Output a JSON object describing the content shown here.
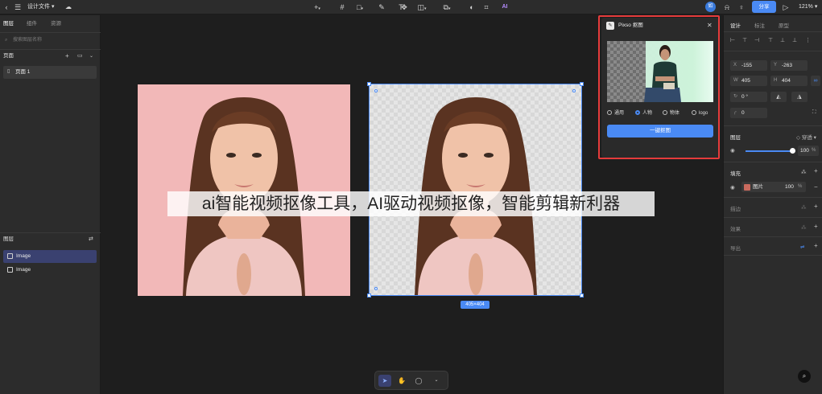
{
  "topbar": {
    "file_title": "设计文件",
    "avatar": "如",
    "share_label": "分享",
    "zoom": "121%",
    "icons": [
      "back-icon",
      "menu-icon",
      "chevron-down-icon",
      "cloud-icon",
      "add-icon",
      "frame-icon",
      "rectangle-icon",
      "pen-icon",
      "text-icon",
      "component-icon",
      "mask-icon",
      "boolean-icon",
      "crop-icon",
      "plugin-ai-icon",
      "bell-icon",
      "bulb-icon",
      "play-icon"
    ]
  },
  "left_panel": {
    "tabs": [
      "图层",
      "组件",
      "资源"
    ],
    "active_tab": "图层",
    "search_placeholder": "搜索图层名称",
    "pages_title": "页面",
    "pages": [
      "页面 1"
    ],
    "layers_title": "图层",
    "layers": [
      {
        "name": "Image",
        "selected": true
      },
      {
        "name": "Image",
        "selected": false
      }
    ]
  },
  "canvas": {
    "size_badge": "405×404",
    "watermark": "ai智能视频抠像工具，AI驱动视频抠像，智能剪辑新利器"
  },
  "plugin": {
    "title": "Pixso 抠图",
    "options": [
      {
        "label": "通用",
        "checked": false
      },
      {
        "label": "人物",
        "checked": true
      },
      {
        "label": "物体",
        "checked": false
      },
      {
        "label": "logo",
        "checked": false
      }
    ],
    "action_label": "一键抠图",
    "highlight_color": "#e53b3b"
  },
  "right_panel": {
    "tabs": [
      "设计",
      "标注",
      "原型"
    ],
    "active_tab": "设计",
    "x_label": "X",
    "x": "-155",
    "y_label": "Y",
    "y": "-263",
    "w_label": "W",
    "w": "405",
    "h_label": "H",
    "h": "404",
    "rotation": "0 °",
    "radius": "0",
    "layer_title": "图层",
    "blend": "穿透",
    "opacity": "100",
    "opacity_unit": "%",
    "fill_title": "填充",
    "fill_type": "图片",
    "fill_opacity": "100",
    "fill_unit": "%",
    "stroke_title": "描边",
    "effect_title": "效果",
    "export_title": "导出"
  },
  "colors": {
    "accent": "#4a8af4",
    "panel_bg": "#2c2c2c",
    "canvas_bg": "#1e1e1e",
    "pink_bg": "#f2b8b8"
  }
}
